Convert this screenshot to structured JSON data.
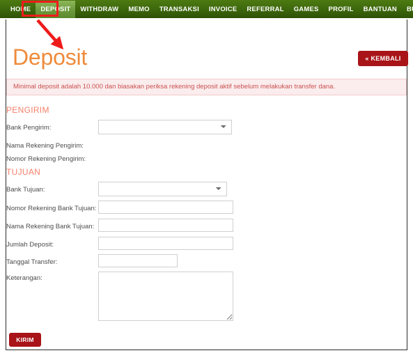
{
  "nav": {
    "items": [
      {
        "label": "HOME",
        "active": false
      },
      {
        "label": "DEPOSIT",
        "active": true
      },
      {
        "label": "WITHDRAW",
        "active": false
      },
      {
        "label": "MEMO",
        "active": false
      },
      {
        "label": "TRANSAKSI",
        "active": false
      },
      {
        "label": "INVOICE",
        "active": false
      },
      {
        "label": "REFERRAL",
        "active": false
      },
      {
        "label": "GAMES",
        "active": false
      },
      {
        "label": "PROFIL",
        "active": false
      },
      {
        "label": "BANTUAN",
        "active": false
      },
      {
        "label": "BUKU MIMPI",
        "active": false
      }
    ]
  },
  "header": {
    "title": "Deposit",
    "back_label": "« KEMBALI"
  },
  "alert": {
    "text": "Minimal deposit adalah 10.000 dan biasakan periksa rekening deposit aktif sebelum melakukan transfer dana."
  },
  "sections": {
    "pengirim": {
      "heading": "PENGIRIM",
      "fields": [
        {
          "label": "Bank Pengirim:",
          "value": "",
          "placeholder": ""
        },
        {
          "label": "Nama Rekening Pengirim:",
          "value": ""
        },
        {
          "label": "Nomor Rekening Pengirim:",
          "value": ""
        }
      ]
    },
    "tujuan": {
      "heading": "TUJUAN",
      "fields": [
        {
          "label": "Bank Tujuan:",
          "value": "",
          "placeholder": ""
        },
        {
          "label": "Nomor Rekening Bank Tujuan:",
          "value": "",
          "placeholder": ""
        },
        {
          "label": "Nama Rekening Bank Tujuan:",
          "value": "",
          "placeholder": ""
        },
        {
          "label": "Jumlah Deposit:",
          "value": "",
          "placeholder": ""
        },
        {
          "label": "Tanggal Transfer:",
          "value": "",
          "placeholder": ""
        },
        {
          "label": "Keterangan:",
          "value": "",
          "placeholder": ""
        }
      ]
    }
  },
  "form": {
    "submit_label": "KIRIM"
  },
  "annotation": {
    "box_target": "DEPOSIT",
    "color": "#ee1b1b"
  },
  "colors": {
    "navbar_green": "#3f6a0d",
    "nav_active_green": "#6d9a3c",
    "title_orange": "#ef8b3b",
    "section_heading": "#f4806a",
    "button_red": "#a81418",
    "alert_bg": "#fbeced",
    "alert_text": "#c9524f",
    "annotation_red": "#ee1b1b"
  }
}
